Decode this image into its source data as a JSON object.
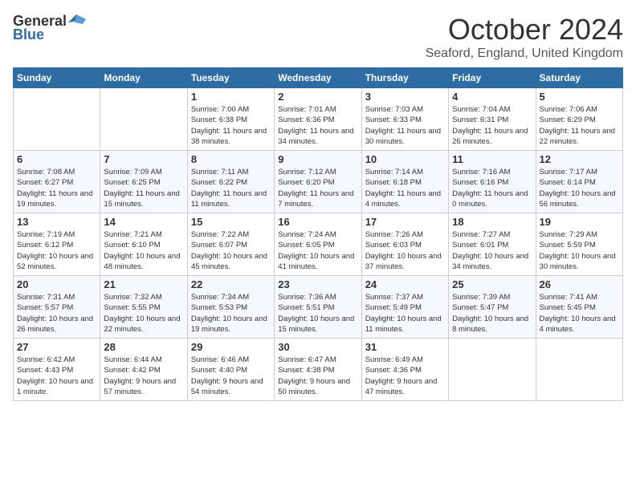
{
  "header": {
    "logo_general": "General",
    "logo_blue": "Blue",
    "month": "October 2024",
    "location": "Seaford, England, United Kingdom"
  },
  "days_of_week": [
    "Sunday",
    "Monday",
    "Tuesday",
    "Wednesday",
    "Thursday",
    "Friday",
    "Saturday"
  ],
  "weeks": [
    [
      {
        "day": "",
        "info": ""
      },
      {
        "day": "",
        "info": ""
      },
      {
        "day": "1",
        "info": "Sunrise: 7:00 AM\nSunset: 6:38 PM\nDaylight: 11 hours and 38 minutes."
      },
      {
        "day": "2",
        "info": "Sunrise: 7:01 AM\nSunset: 6:36 PM\nDaylight: 11 hours and 34 minutes."
      },
      {
        "day": "3",
        "info": "Sunrise: 7:03 AM\nSunset: 6:33 PM\nDaylight: 11 hours and 30 minutes."
      },
      {
        "day": "4",
        "info": "Sunrise: 7:04 AM\nSunset: 6:31 PM\nDaylight: 11 hours and 26 minutes."
      },
      {
        "day": "5",
        "info": "Sunrise: 7:06 AM\nSunset: 6:29 PM\nDaylight: 11 hours and 22 minutes."
      }
    ],
    [
      {
        "day": "6",
        "info": "Sunrise: 7:08 AM\nSunset: 6:27 PM\nDaylight: 11 hours and 19 minutes."
      },
      {
        "day": "7",
        "info": "Sunrise: 7:09 AM\nSunset: 6:25 PM\nDaylight: 11 hours and 15 minutes."
      },
      {
        "day": "8",
        "info": "Sunrise: 7:11 AM\nSunset: 6:22 PM\nDaylight: 11 hours and 11 minutes."
      },
      {
        "day": "9",
        "info": "Sunrise: 7:12 AM\nSunset: 6:20 PM\nDaylight: 11 hours and 7 minutes."
      },
      {
        "day": "10",
        "info": "Sunrise: 7:14 AM\nSunset: 6:18 PM\nDaylight: 11 hours and 4 minutes."
      },
      {
        "day": "11",
        "info": "Sunrise: 7:16 AM\nSunset: 6:16 PM\nDaylight: 11 hours and 0 minutes."
      },
      {
        "day": "12",
        "info": "Sunrise: 7:17 AM\nSunset: 6:14 PM\nDaylight: 10 hours and 56 minutes."
      }
    ],
    [
      {
        "day": "13",
        "info": "Sunrise: 7:19 AM\nSunset: 6:12 PM\nDaylight: 10 hours and 52 minutes."
      },
      {
        "day": "14",
        "info": "Sunrise: 7:21 AM\nSunset: 6:10 PM\nDaylight: 10 hours and 48 minutes."
      },
      {
        "day": "15",
        "info": "Sunrise: 7:22 AM\nSunset: 6:07 PM\nDaylight: 10 hours and 45 minutes."
      },
      {
        "day": "16",
        "info": "Sunrise: 7:24 AM\nSunset: 6:05 PM\nDaylight: 10 hours and 41 minutes."
      },
      {
        "day": "17",
        "info": "Sunrise: 7:26 AM\nSunset: 6:03 PM\nDaylight: 10 hours and 37 minutes."
      },
      {
        "day": "18",
        "info": "Sunrise: 7:27 AM\nSunset: 6:01 PM\nDaylight: 10 hours and 34 minutes."
      },
      {
        "day": "19",
        "info": "Sunrise: 7:29 AM\nSunset: 5:59 PM\nDaylight: 10 hours and 30 minutes."
      }
    ],
    [
      {
        "day": "20",
        "info": "Sunrise: 7:31 AM\nSunset: 5:57 PM\nDaylight: 10 hours and 26 minutes."
      },
      {
        "day": "21",
        "info": "Sunrise: 7:32 AM\nSunset: 5:55 PM\nDaylight: 10 hours and 22 minutes."
      },
      {
        "day": "22",
        "info": "Sunrise: 7:34 AM\nSunset: 5:53 PM\nDaylight: 10 hours and 19 minutes."
      },
      {
        "day": "23",
        "info": "Sunrise: 7:36 AM\nSunset: 5:51 PM\nDaylight: 10 hours and 15 minutes."
      },
      {
        "day": "24",
        "info": "Sunrise: 7:37 AM\nSunset: 5:49 PM\nDaylight: 10 hours and 11 minutes."
      },
      {
        "day": "25",
        "info": "Sunrise: 7:39 AM\nSunset: 5:47 PM\nDaylight: 10 hours and 8 minutes."
      },
      {
        "day": "26",
        "info": "Sunrise: 7:41 AM\nSunset: 5:45 PM\nDaylight: 10 hours and 4 minutes."
      }
    ],
    [
      {
        "day": "27",
        "info": "Sunrise: 6:42 AM\nSunset: 4:43 PM\nDaylight: 10 hours and 1 minute."
      },
      {
        "day": "28",
        "info": "Sunrise: 6:44 AM\nSunset: 4:42 PM\nDaylight: 9 hours and 57 minutes."
      },
      {
        "day": "29",
        "info": "Sunrise: 6:46 AM\nSunset: 4:40 PM\nDaylight: 9 hours and 54 minutes."
      },
      {
        "day": "30",
        "info": "Sunrise: 6:47 AM\nSunset: 4:38 PM\nDaylight: 9 hours and 50 minutes."
      },
      {
        "day": "31",
        "info": "Sunrise: 6:49 AM\nSunset: 4:36 PM\nDaylight: 9 hours and 47 minutes."
      },
      {
        "day": "",
        "info": ""
      },
      {
        "day": "",
        "info": ""
      }
    ]
  ]
}
